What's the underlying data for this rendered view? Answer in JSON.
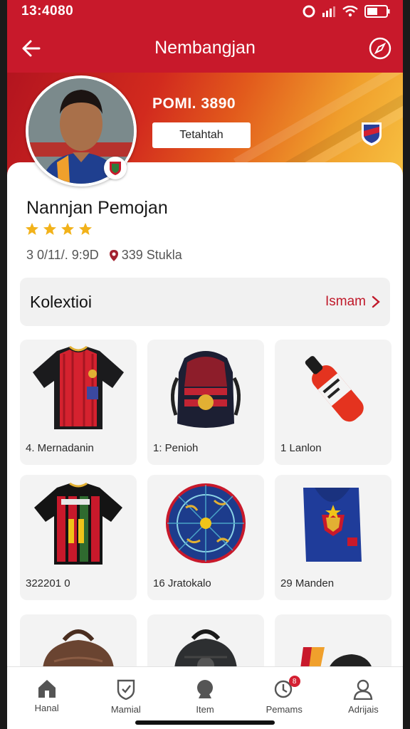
{
  "status": {
    "time": "13:4080"
  },
  "appbar": {
    "title": "Nembangjan"
  },
  "profile": {
    "points": "POMI. 3890",
    "detail_button": "Tetahtah",
    "name": "Nannjan Pemojan",
    "rating": 4,
    "date": "3 0/11/. 9:9D",
    "location": "339 Stukla"
  },
  "collection": {
    "title": "Kolextioi",
    "link": "Ismam"
  },
  "items": [
    {
      "label": "4. Mernadanin",
      "icon": "jersey-red-icon"
    },
    {
      "label": "1: Penioh",
      "icon": "backpack-icon"
    },
    {
      "label": "1 Lanlon",
      "icon": "bottle-icon"
    },
    {
      "label": "322201 0",
      "icon": "jersey-striped-icon"
    },
    {
      "label": "16 Jratokalo",
      "icon": "ball-icon"
    },
    {
      "label": "29 Manden",
      "icon": "scarf-icon"
    },
    {
      "label": "",
      "icon": "bag-brown-icon"
    },
    {
      "label": "",
      "icon": "backpack-black-icon"
    },
    {
      "label": "",
      "icon": "cap-icon"
    }
  ],
  "nav": [
    {
      "label": "Hanal",
      "icon": "home-icon"
    },
    {
      "label": "Mamial",
      "icon": "shield-icon"
    },
    {
      "label": "Item",
      "icon": "item-icon"
    },
    {
      "label": "Pemams",
      "icon": "notification-icon",
      "badge": "8"
    },
    {
      "label": "Adrijais",
      "icon": "profile-icon"
    }
  ],
  "colors": {
    "brand": "#c8192b",
    "accent": "#f0a02c",
    "star": "#f2b21a"
  }
}
